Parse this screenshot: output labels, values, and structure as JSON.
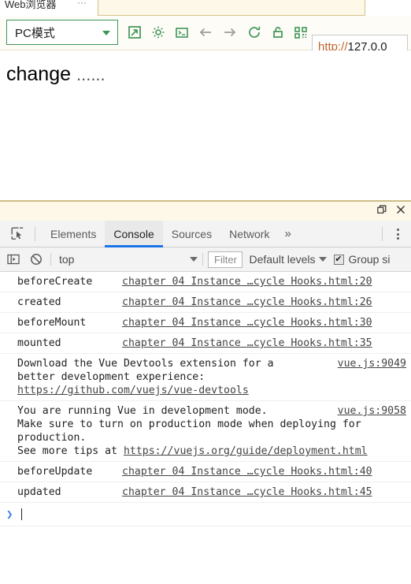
{
  "browser": {
    "tab": {
      "title": "Web浏览器",
      "dots": "···"
    },
    "toolbar": {
      "mode_select": {
        "value": "PC模式",
        "caret": "chevron-down-icon"
      },
      "icons": [
        {
          "name": "open-external-icon",
          "color": "#3f9557"
        },
        {
          "name": "gear-icon",
          "color": "#3f9557"
        },
        {
          "name": "console-terminal-icon",
          "color": "#3f9557"
        },
        {
          "name": "back-arrow-icon",
          "color": "#9b9b9b"
        },
        {
          "name": "forward-arrow-icon",
          "color": "#9b9b9b"
        },
        {
          "name": "reload-icon",
          "color": "#3f9557"
        },
        {
          "name": "lock-open-icon",
          "color": "#3f9557"
        },
        {
          "name": "qr-code-icon",
          "color": "#3f9557"
        }
      ],
      "url": {
        "scheme": "http://",
        "host": "127.0.0",
        "full": "http://127.0.0"
      }
    },
    "page": {
      "heading": "change",
      "heading_dots": "......"
    }
  },
  "devtools": {
    "window_controls": [
      {
        "name": "restore-window-icon"
      },
      {
        "name": "close-devtools-icon"
      }
    ],
    "inspect_button": "inspect-element-icon",
    "tabs": [
      {
        "label": "Elements",
        "active": false
      },
      {
        "label": "Console",
        "active": true
      },
      {
        "label": "Sources",
        "active": false
      },
      {
        "label": "Network",
        "active": false
      }
    ],
    "tabs_overflow": "»",
    "console_toolbar": {
      "sidebar_toggle": "console-sidebar-icon",
      "clear_console": "clear-console-icon",
      "context": "top",
      "filter_placeholder": "Filter",
      "levels": "Default levels",
      "group_similar_checked": true,
      "group_similar_label": "Group si",
      "check_glyph": "✔"
    },
    "messages": [
      {
        "text": "beforeCreate",
        "link": "chapter 04 Instance …cycle Hooks.html:20",
        "wide": false
      },
      {
        "text": "created",
        "link": "chapter 04 Instance …cycle Hooks.html:26",
        "wide": false
      },
      {
        "text": "beforeMount",
        "link": "chapter 04 Instance …cycle Hooks.html:30",
        "wide": false
      },
      {
        "text": "mounted",
        "link": "chapter 04 Instance …cycle Hooks.html:35",
        "wide": false
      },
      {
        "text": "Download the Vue Devtools extension for a\nbetter development experience:\nhttps://github.com/vuejs/vue-devtools",
        "link": "vue.js:9049",
        "wide": true,
        "multiline": true,
        "underline_last_line": true
      },
      {
        "text": "You are running Vue in development mode.\nMake sure to turn on production mode when deploying for\nproduction.\nSee more tips at https://vuejs.org/guide/deployment.html",
        "link": "vue.js:9058",
        "wide": true,
        "multiline": true
      },
      {
        "text": "beforeUpdate",
        "link": "chapter 04 Instance …cycle Hooks.html:40",
        "wide": false
      },
      {
        "text": "updated",
        "link": "chapter 04 Instance …cycle Hooks.html:45",
        "wide": false
      }
    ],
    "prompt": {
      "chevron": "❯",
      "value": ""
    }
  }
}
